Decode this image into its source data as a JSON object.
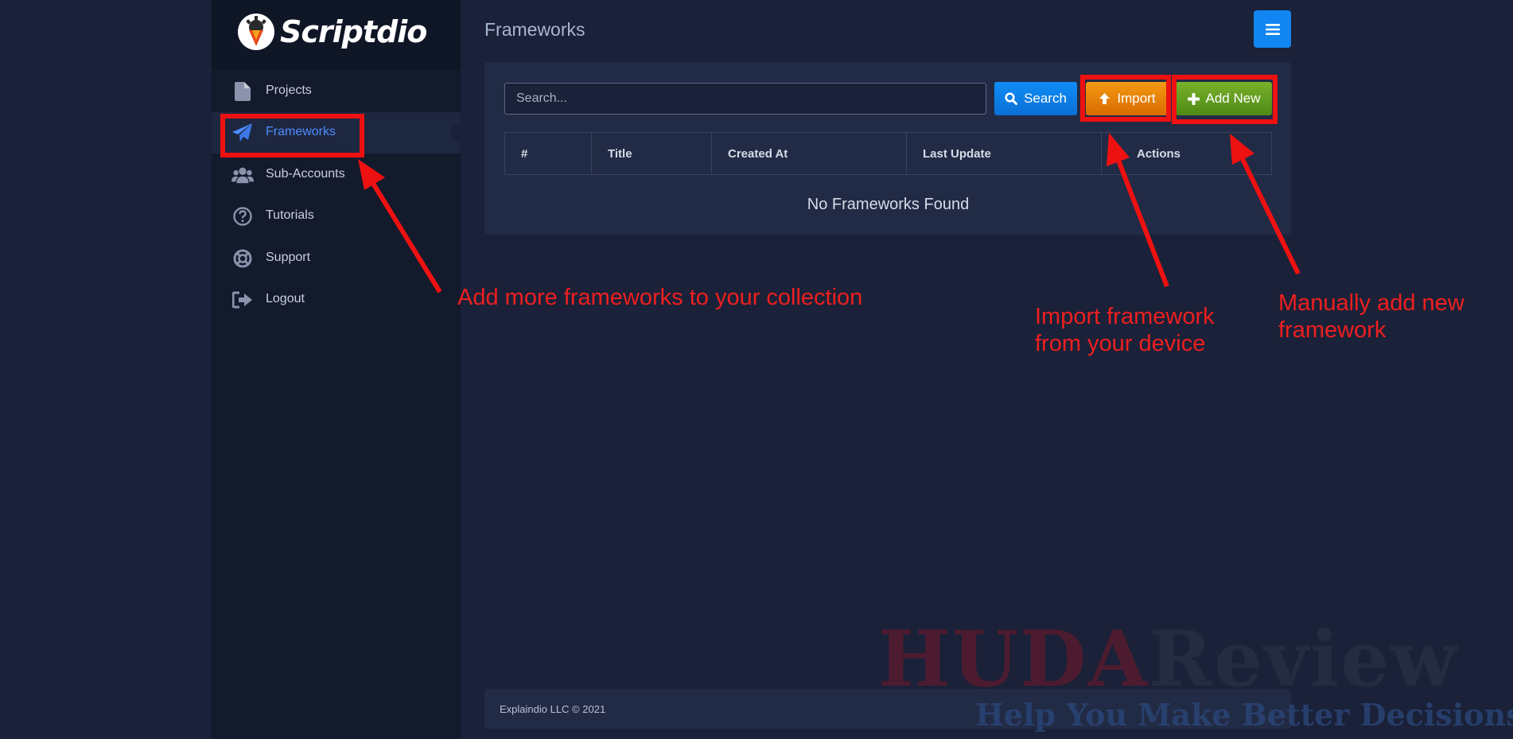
{
  "app": {
    "brand_name": "Scriptdio",
    "page_title": "Frameworks"
  },
  "sidebar": {
    "items": [
      {
        "label": "Projects",
        "icon": "file-icon",
        "active": false
      },
      {
        "label": "Frameworks",
        "icon": "paper-plane-icon",
        "active": true
      },
      {
        "label": "Sub-Accounts",
        "icon": "users-icon",
        "active": false
      },
      {
        "label": "Tutorials",
        "icon": "question-circle-icon",
        "active": false
      },
      {
        "label": "Support",
        "icon": "life-ring-icon",
        "active": false
      },
      {
        "label": "Logout",
        "icon": "sign-out-icon",
        "active": false
      }
    ]
  },
  "toolbar": {
    "search_placeholder": "Search...",
    "search_value": "",
    "search_label": "Search",
    "import_label": "Import",
    "add_label": "Add New",
    "menu_icon": "bars-icon"
  },
  "table": {
    "columns": [
      "#",
      "Title",
      "Created At",
      "Last Update",
      "Actions"
    ],
    "empty_message": "No Frameworks Found"
  },
  "footer": {
    "text": "Explaindio LLC © 2021"
  },
  "annotations": {
    "sidebar_note": "Add more frameworks to your collection",
    "import_note": [
      "Import framework",
      "from your device"
    ],
    "add_note": [
      "Manually add new",
      "framework"
    ]
  },
  "watermark": {
    "brand_part1": "HUDA",
    "brand_part2": "Review",
    "tagline": "Help You Make Better Decisions"
  },
  "colors": {
    "background": "#1a2138",
    "sidebar": "#121a2c",
    "card": "#222b45",
    "accent_blue": "#1186f2",
    "active_link": "#4d8dff",
    "import_orange": "#e8820a",
    "add_green": "#639e20",
    "annotation_red": "#ee1f1f"
  }
}
